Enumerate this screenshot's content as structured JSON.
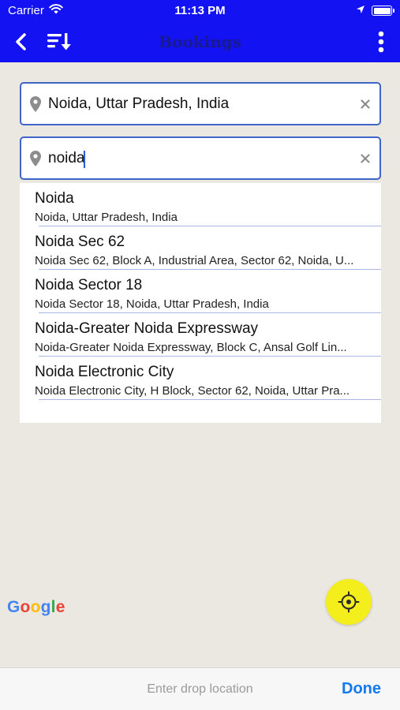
{
  "status_bar": {
    "carrier": "Carrier",
    "time": "11:13 PM"
  },
  "nav": {
    "title": "Bookings"
  },
  "pickup": {
    "value": "Noida, Uttar Pradesh, India"
  },
  "search": {
    "value": "noida"
  },
  "suggestions": [
    {
      "title": "Noida",
      "subtitle": "Noida, Uttar Pradesh, India"
    },
    {
      "title": "Noida Sec 62",
      "subtitle": "Noida Sec 62, Block A, Industrial Area, Sector 62, Noida, U..."
    },
    {
      "title": "Noida Sector 18",
      "subtitle": "Noida Sector 18, Noida, Uttar Pradesh, India"
    },
    {
      "title": "Noida-Greater Noida Expressway",
      "subtitle": "Noida-Greater Noida Expressway, Block C, Ansal Golf Lin..."
    },
    {
      "title": "Noida Electronic City",
      "subtitle": "Noida Electronic City, H Block, Sector 62, Noida, Uttar Pra..."
    }
  ],
  "map": {
    "attribution": "Google"
  },
  "bottom_bar": {
    "placeholder": "Enter drop location",
    "done_label": "Done"
  },
  "colors": {
    "nav_background": "#1212f3",
    "title_color": "#1a1a8f",
    "field_border": "#3f66c4",
    "locate_button": "#f4ee1c",
    "done_color": "#1479f0",
    "map_background": "#ebe8e1"
  }
}
